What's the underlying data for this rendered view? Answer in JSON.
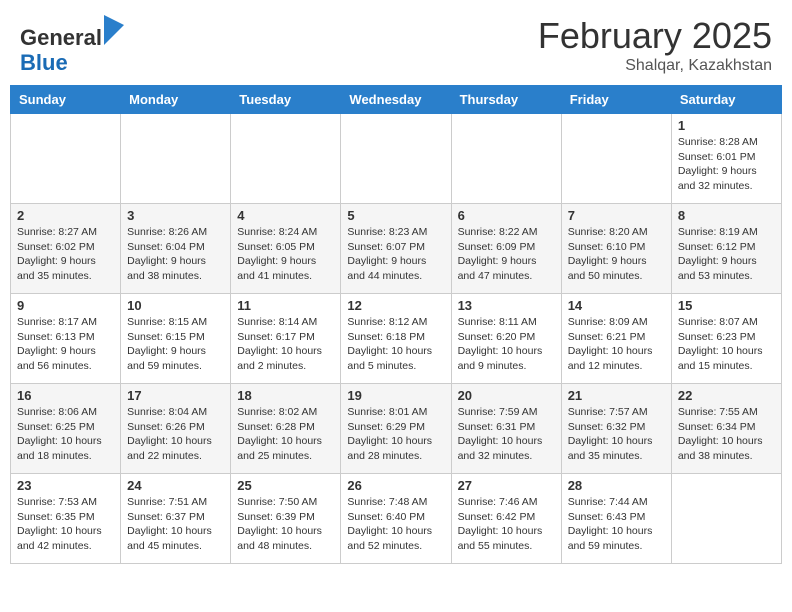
{
  "header": {
    "logo_general": "General",
    "logo_blue": "Blue",
    "month_year": "February 2025",
    "location": "Shalqar, Kazakhstan"
  },
  "weekdays": [
    "Sunday",
    "Monday",
    "Tuesday",
    "Wednesday",
    "Thursday",
    "Friday",
    "Saturday"
  ],
  "weeks": [
    [
      {
        "day": "",
        "info": ""
      },
      {
        "day": "",
        "info": ""
      },
      {
        "day": "",
        "info": ""
      },
      {
        "day": "",
        "info": ""
      },
      {
        "day": "",
        "info": ""
      },
      {
        "day": "",
        "info": ""
      },
      {
        "day": "1",
        "info": "Sunrise: 8:28 AM\nSunset: 6:01 PM\nDaylight: 9 hours and 32 minutes."
      }
    ],
    [
      {
        "day": "2",
        "info": "Sunrise: 8:27 AM\nSunset: 6:02 PM\nDaylight: 9 hours and 35 minutes."
      },
      {
        "day": "3",
        "info": "Sunrise: 8:26 AM\nSunset: 6:04 PM\nDaylight: 9 hours and 38 minutes."
      },
      {
        "day": "4",
        "info": "Sunrise: 8:24 AM\nSunset: 6:05 PM\nDaylight: 9 hours and 41 minutes."
      },
      {
        "day": "5",
        "info": "Sunrise: 8:23 AM\nSunset: 6:07 PM\nDaylight: 9 hours and 44 minutes."
      },
      {
        "day": "6",
        "info": "Sunrise: 8:22 AM\nSunset: 6:09 PM\nDaylight: 9 hours and 47 minutes."
      },
      {
        "day": "7",
        "info": "Sunrise: 8:20 AM\nSunset: 6:10 PM\nDaylight: 9 hours and 50 minutes."
      },
      {
        "day": "8",
        "info": "Sunrise: 8:19 AM\nSunset: 6:12 PM\nDaylight: 9 hours and 53 minutes."
      }
    ],
    [
      {
        "day": "9",
        "info": "Sunrise: 8:17 AM\nSunset: 6:13 PM\nDaylight: 9 hours and 56 minutes."
      },
      {
        "day": "10",
        "info": "Sunrise: 8:15 AM\nSunset: 6:15 PM\nDaylight: 9 hours and 59 minutes."
      },
      {
        "day": "11",
        "info": "Sunrise: 8:14 AM\nSunset: 6:17 PM\nDaylight: 10 hours and 2 minutes."
      },
      {
        "day": "12",
        "info": "Sunrise: 8:12 AM\nSunset: 6:18 PM\nDaylight: 10 hours and 5 minutes."
      },
      {
        "day": "13",
        "info": "Sunrise: 8:11 AM\nSunset: 6:20 PM\nDaylight: 10 hours and 9 minutes."
      },
      {
        "day": "14",
        "info": "Sunrise: 8:09 AM\nSunset: 6:21 PM\nDaylight: 10 hours and 12 minutes."
      },
      {
        "day": "15",
        "info": "Sunrise: 8:07 AM\nSunset: 6:23 PM\nDaylight: 10 hours and 15 minutes."
      }
    ],
    [
      {
        "day": "16",
        "info": "Sunrise: 8:06 AM\nSunset: 6:25 PM\nDaylight: 10 hours and 18 minutes."
      },
      {
        "day": "17",
        "info": "Sunrise: 8:04 AM\nSunset: 6:26 PM\nDaylight: 10 hours and 22 minutes."
      },
      {
        "day": "18",
        "info": "Sunrise: 8:02 AM\nSunset: 6:28 PM\nDaylight: 10 hours and 25 minutes."
      },
      {
        "day": "19",
        "info": "Sunrise: 8:01 AM\nSunset: 6:29 PM\nDaylight: 10 hours and 28 minutes."
      },
      {
        "day": "20",
        "info": "Sunrise: 7:59 AM\nSunset: 6:31 PM\nDaylight: 10 hours and 32 minutes."
      },
      {
        "day": "21",
        "info": "Sunrise: 7:57 AM\nSunset: 6:32 PM\nDaylight: 10 hours and 35 minutes."
      },
      {
        "day": "22",
        "info": "Sunrise: 7:55 AM\nSunset: 6:34 PM\nDaylight: 10 hours and 38 minutes."
      }
    ],
    [
      {
        "day": "23",
        "info": "Sunrise: 7:53 AM\nSunset: 6:35 PM\nDaylight: 10 hours and 42 minutes."
      },
      {
        "day": "24",
        "info": "Sunrise: 7:51 AM\nSunset: 6:37 PM\nDaylight: 10 hours and 45 minutes."
      },
      {
        "day": "25",
        "info": "Sunrise: 7:50 AM\nSunset: 6:39 PM\nDaylight: 10 hours and 48 minutes."
      },
      {
        "day": "26",
        "info": "Sunrise: 7:48 AM\nSunset: 6:40 PM\nDaylight: 10 hours and 52 minutes."
      },
      {
        "day": "27",
        "info": "Sunrise: 7:46 AM\nSunset: 6:42 PM\nDaylight: 10 hours and 55 minutes."
      },
      {
        "day": "28",
        "info": "Sunrise: 7:44 AM\nSunset: 6:43 PM\nDaylight: 10 hours and 59 minutes."
      },
      {
        "day": "",
        "info": ""
      }
    ]
  ]
}
